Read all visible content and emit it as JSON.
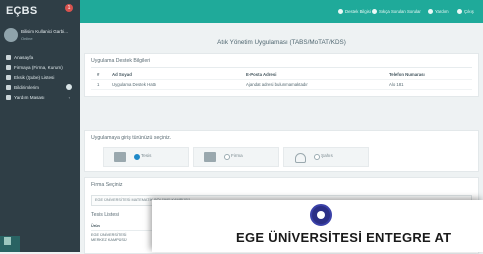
{
  "sidebar": {
    "logo_text": "EÇBS",
    "logo_sub": "",
    "notification_count": "1",
    "user_name": "Bilisim Kullanici Garbi...",
    "user_status": "Online",
    "items": [
      {
        "label": "Anasayfa"
      },
      {
        "label": "Firmaya (Firma, Kurum)"
      },
      {
        "label": "Eksik (Şube) Listesi"
      },
      {
        "label": "Bildirimlerim"
      },
      {
        "label": "Yardım Masası"
      }
    ]
  },
  "topbar": {
    "btn1": "Destek Bilgisi",
    "btn2": "Sıkça Sorulan Sorular",
    "btn3": "Yardım",
    "btn4": "Çıkış",
    "color": "#1faa9a"
  },
  "page": {
    "title": "Atık Yönetim Uygulaması (TABS/MoTAT/KDS)"
  },
  "contact_card": {
    "title": "Uygulama Destek Bilgileri",
    "headers": [
      "#",
      "Ad Soyad",
      "E-Posta Adresi",
      "Telefon Numarası"
    ],
    "rows": [
      [
        "1",
        "Uygulama Destek Hattı",
        "Ajandat adresi bulunmamaktadır",
        "Alo 181"
      ]
    ]
  },
  "login_type": {
    "title": "Uygulamaya giriş türünüzü seçiniz.",
    "options": [
      {
        "label": "Tesis",
        "icon": "factory-icon",
        "selected": true
      },
      {
        "label": "Firma",
        "icon": "briefcase-icon",
        "selected": false
      },
      {
        "label": "Şahıs",
        "icon": "person-icon",
        "selected": false
      }
    ]
  },
  "firm_card": {
    "title": "Firma Seçiniz",
    "selected_firm": "EGE ÜNİVERSİTESİ MATEMATİK BÖLÜMÜ KAMPÜSÜ",
    "facility_list_title": "Tesis Listesi",
    "table_header": "Ürün",
    "facility_name": "EGE ÜNİVERSİTESİ MERKEZ KAMPÜSÜ"
  },
  "overlay": {
    "title": "EGE ÜNİVERSİTESİ ENTEGRE AT"
  }
}
